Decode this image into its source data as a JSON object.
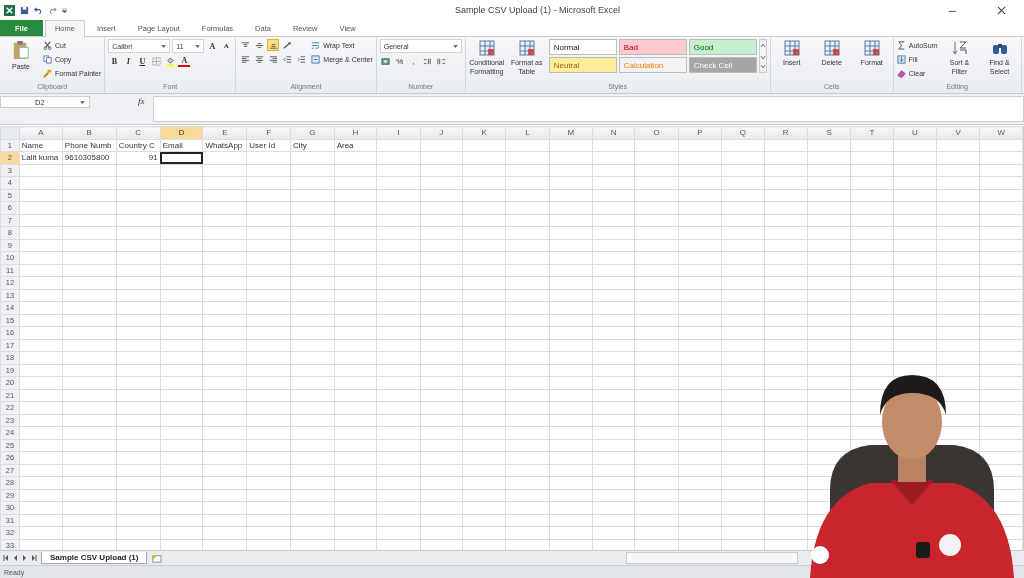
{
  "window": {
    "title": "Sample CSV Upload (1)  -  Microsoft Excel"
  },
  "ribbon_tabs": [
    {
      "label": "File",
      "kind": "file",
      "selected": false
    },
    {
      "label": "Home",
      "kind": "tab",
      "selected": true
    },
    {
      "label": "Insert",
      "kind": "tab",
      "selected": false
    },
    {
      "label": "Page Layout",
      "kind": "tab",
      "selected": false
    },
    {
      "label": "Formulas",
      "kind": "tab",
      "selected": false
    },
    {
      "label": "Data",
      "kind": "tab",
      "selected": false
    },
    {
      "label": "Review",
      "kind": "tab",
      "selected": false
    },
    {
      "label": "View",
      "kind": "tab",
      "selected": false
    }
  ],
  "ribbon_groups": [
    {
      "label": "Clipboard",
      "items": [
        {
          "kind": "paste",
          "label": "Paste"
        },
        {
          "kind": "stack",
          "items": [
            {
              "kind": "cut",
              "label": "Cut"
            },
            {
              "kind": "copy",
              "label": "Copy"
            },
            {
              "kind": "painter",
              "label": "Format Painter"
            }
          ]
        }
      ]
    },
    {
      "label": "Font",
      "items": [
        {
          "kind": "stack",
          "items": [
            {
              "kind": "row",
              "items": [
                {
                  "kind": "dropdown",
                  "label": "Calibri"
                },
                {
                  "kind": "dropdown",
                  "label": "11"
                },
                {
                  "kind": "grow",
                  "label": "A",
                  "on": false
                },
                {
                  "kind": "shrink",
                  "label": "A",
                  "on": false
                }
              ]
            },
            {
              "kind": "row",
              "items": [
                {
                  "kind": "bold",
                  "label": "B",
                  "on": false
                },
                {
                  "kind": "italic",
                  "label": "I",
                  "on": false
                },
                {
                  "kind": "underline",
                  "label": "U",
                  "on": false
                },
                {
                  "kind": "borders",
                  "on": false
                },
                {
                  "kind": "fillcolor",
                  "on": false
                },
                {
                  "kind": "fontcolor",
                  "label": "A",
                  "on": false
                }
              ]
            }
          ]
        }
      ]
    },
    {
      "label": "Alignment",
      "items": [
        {
          "kind": "stack",
          "items": [
            {
              "kind": "row",
              "items": [
                {
                  "kind": "aligntop",
                  "on": false
                },
                {
                  "kind": "alignmiddle",
                  "on": false
                },
                {
                  "kind": "alignbottom",
                  "on": true
                },
                {
                  "kind": "orient",
                  "on": false
                }
              ]
            },
            {
              "kind": "row",
              "items": [
                {
                  "kind": "alignleft",
                  "on": false
                },
                {
                  "kind": "aligncenter",
                  "on": false
                },
                {
                  "kind": "alignright",
                  "on": false
                },
                {
                  "kind": "outdent",
                  "on": false
                },
                {
                  "kind": "indent",
                  "on": false
                }
              ]
            }
          ]
        },
        {
          "kind": "stack",
          "items": [
            {
              "kind": "wrap",
              "label": "Wrap Text"
            },
            {
              "kind": "merge",
              "label": "Merge & Center"
            }
          ]
        }
      ]
    },
    {
      "label": "Number",
      "items": [
        {
          "kind": "stack",
          "items": [
            {
              "kind": "dropdown",
              "label": "General"
            },
            {
              "kind": "row",
              "items": [
                {
                  "kind": "currency",
                  "on": false
                },
                {
                  "kind": "percent",
                  "label": "%",
                  "on": false
                },
                {
                  "kind": "comma",
                  "label": ",",
                  "on": false
                },
                {
                  "kind": "incdecimal",
                  "on": false
                },
                {
                  "kind": "decdecimal",
                  "on": false
                }
              ]
            }
          ]
        }
      ]
    },
    {
      "label": "Styles",
      "items": [
        {
          "kind": "conditional",
          "label": "Conditional Formatting"
        },
        {
          "kind": "formattable",
          "label": "Format as Table"
        },
        {
          "kind": "gallery",
          "items": [
            {
              "label": "Normal",
              "color": "#ffffff"
            },
            {
              "label": "Bad",
              "color": "#ffc7ce"
            },
            {
              "label": "Good",
              "color": "#c6efce"
            },
            {
              "label": "Neutral",
              "color": "#ffeb9c"
            },
            {
              "label": "Calculation",
              "color": "#f2f2f2"
            },
            {
              "label": "Check Cell",
              "color": "#a5a5a5"
            }
          ]
        }
      ]
    },
    {
      "label": "Cells",
      "items": [
        {
          "kind": "insert",
          "label": "Insert"
        },
        {
          "kind": "delete",
          "label": "Delete"
        },
        {
          "kind": "format",
          "label": "Format"
        }
      ]
    },
    {
      "label": "Editing",
      "items": [
        {
          "kind": "stack",
          "items": [
            {
              "kind": "autosum",
              "label": "AutoSum"
            },
            {
              "kind": "fill",
              "label": "Fill"
            },
            {
              "kind": "clear",
              "label": "Clear"
            }
          ]
        },
        {
          "kind": "sort",
          "label": "Sort & Filter"
        },
        {
          "kind": "find",
          "label": "Find & Select"
        }
      ]
    }
  ],
  "formula_bar": {
    "name_box": "D2",
    "function_label": "fx"
  },
  "columns": [
    {
      "label": "A",
      "selected": false
    },
    {
      "label": "B",
      "selected": false
    },
    {
      "label": "C",
      "selected": false
    },
    {
      "label": "D",
      "selected": true
    },
    {
      "label": "E",
      "selected": false
    },
    {
      "label": "F",
      "selected": false
    },
    {
      "label": "G",
      "selected": false
    },
    {
      "label": "H",
      "selected": false
    },
    {
      "label": "I",
      "selected": false
    },
    {
      "label": "J",
      "selected": false
    },
    {
      "label": "K",
      "selected": false
    },
    {
      "label": "L",
      "selected": false
    },
    {
      "label": "M",
      "selected": false
    },
    {
      "label": "N",
      "selected": false
    },
    {
      "label": "O",
      "selected": false
    },
    {
      "label": "P",
      "selected": false
    },
    {
      "label": "Q",
      "selected": false
    },
    {
      "label": "R",
      "selected": false
    },
    {
      "label": "S",
      "selected": false
    },
    {
      "label": "T",
      "selected": false
    },
    {
      "label": "U",
      "selected": false
    },
    {
      "label": "V",
      "selected": false
    },
    {
      "label": "W",
      "selected": false
    }
  ],
  "rows": [
    {
      "label": "1",
      "selected": false
    },
    {
      "label": "2",
      "selected": true
    },
    {
      "label": "3",
      "selected": false
    },
    {
      "label": "4",
      "selected": false
    },
    {
      "label": "5",
      "selected": false
    },
    {
      "label": "6",
      "selected": false
    },
    {
      "label": "7",
      "selected": false
    },
    {
      "label": "8",
      "selected": false
    },
    {
      "label": "9",
      "selected": false
    },
    {
      "label": "10",
      "selected": false
    },
    {
      "label": "11",
      "selected": false
    },
    {
      "label": "12",
      "selected": false
    },
    {
      "label": "13",
      "selected": false
    },
    {
      "label": "14",
      "selected": false
    },
    {
      "label": "15",
      "selected": false
    },
    {
      "label": "16",
      "selected": false
    },
    {
      "label": "17",
      "selected": false
    },
    {
      "label": "18",
      "selected": false
    },
    {
      "label": "19",
      "selected": false
    },
    {
      "label": "20",
      "selected": false
    },
    {
      "label": "21",
      "selected": false
    },
    {
      "label": "22",
      "selected": false
    },
    {
      "label": "23",
      "selected": false
    },
    {
      "label": "24",
      "selected": false
    },
    {
      "label": "25",
      "selected": false
    },
    {
      "label": "26",
      "selected": false
    },
    {
      "label": "27",
      "selected": false
    },
    {
      "label": "28",
      "selected": false
    },
    {
      "label": "29",
      "selected": false
    },
    {
      "label": "30",
      "selected": false
    },
    {
      "label": "31",
      "selected": false
    },
    {
      "label": "32",
      "selected": false
    },
    {
      "label": "33",
      "selected": false
    }
  ],
  "cells": [
    [
      {
        "kind": "text",
        "text": "Name"
      },
      {
        "kind": "text",
        "text": "Phone Numb"
      },
      {
        "kind": "text",
        "text": "Country C"
      },
      {
        "kind": "text",
        "text": "Email"
      },
      {
        "kind": "text",
        "text": "WhatsApp"
      },
      {
        "kind": "text",
        "text": "User Id"
      },
      {
        "kind": "text",
        "text": "City"
      },
      {
        "kind": "text",
        "text": "Area"
      }
    ],
    [
      {
        "kind": "text",
        "text": "Lalit kuma"
      },
      {
        "kind": "text",
        "text": "9610305800"
      },
      {
        "kind": "number",
        "text": "91"
      },
      {
        "kind": "active"
      }
    ]
  ],
  "sheet_tabs": [
    {
      "label": "Sample CSV Upload (1)",
      "selected": true
    }
  ],
  "status_bar": {
    "text": "Ready"
  },
  "presenter": {
    "kind": "picture"
  }
}
